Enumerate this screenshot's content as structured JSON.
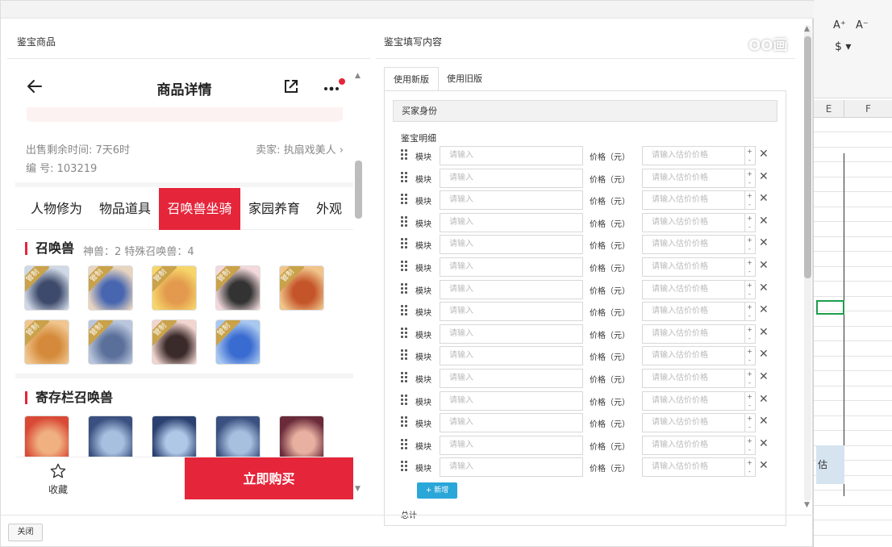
{
  "spreadsheet": {
    "ribbon_buttons": [
      "A⁺",
      "A⁻"
    ],
    "column_headers": [
      "E",
      "F"
    ],
    "cell_fragment": "估"
  },
  "dialog": {
    "left_title": "鉴宝商品",
    "right_title": "鉴宝填写内容",
    "close_label": "关闭"
  },
  "phone": {
    "title": "商品详情",
    "sale_time": "出售剩余时间: 7天6时",
    "seller": "卖家: 执扇戏美人",
    "number": "编 号: 103219",
    "tabs": [
      "人物修为",
      "物品道具",
      "召唤兽坐骑",
      "家园养育",
      "外观"
    ],
    "active_tab": 2,
    "summon_section": {
      "title": "召唤兽",
      "meta": "神兽：2   特殊召唤兽：4"
    },
    "storage_section": {
      "title": "寄存栏召唤兽"
    },
    "badge_text": "管制",
    "favorite_label": "收藏",
    "buy_label": "立即购买",
    "summon_pets": [
      {
        "colors": [
          "#cfd8e6",
          "#3d4a6b"
        ],
        "badge": true
      },
      {
        "colors": [
          "#e8d5c0",
          "#4866b0"
        ],
        "badge": true
      },
      {
        "colors": [
          "#f6d66a",
          "#e39a4e"
        ],
        "badge": true
      },
      {
        "colors": [
          "#f3d9dc",
          "#333333"
        ],
        "badge": true
      },
      {
        "colors": [
          "#f0c48a",
          "#c4552a"
        ],
        "badge": true
      },
      {
        "colors": [
          "#f0c58e",
          "#d48a3a"
        ],
        "badge": true
      },
      {
        "colors": [
          "#b9c6dc",
          "#5a6f9a"
        ],
        "badge": true
      },
      {
        "colors": [
          "#f1d5cf",
          "#3a2a2a"
        ],
        "badge": true
      },
      {
        "colors": [
          "#a8c8f0",
          "#3a6bd0"
        ],
        "badge": true
      }
    ],
    "storage_pets": [
      {
        "colors": [
          "#d94a36",
          "#f0b080"
        ]
      },
      {
        "colors": [
          "#3a5080",
          "#a8c0e0"
        ]
      },
      {
        "colors": [
          "#2a4070",
          "#b0c8e8"
        ]
      },
      {
        "colors": [
          "#3a5080",
          "#a8c0e0"
        ]
      },
      {
        "colors": [
          "#6a2a3a",
          "#e8b0a0"
        ]
      }
    ]
  },
  "form": {
    "tabs": [
      "使用新版",
      "使用旧版"
    ],
    "active_tab": 0,
    "buyer_identity_label": "买家身份",
    "detail_label": "鉴宝明细",
    "row_count": 15,
    "module_label": "模块",
    "module_placeholder": "请输入",
    "price_label": "价格（元）",
    "price_placeholder": "请输入估价价格",
    "add_label": "+ 新增",
    "total_label": "总计"
  },
  "watermark": "OO画"
}
